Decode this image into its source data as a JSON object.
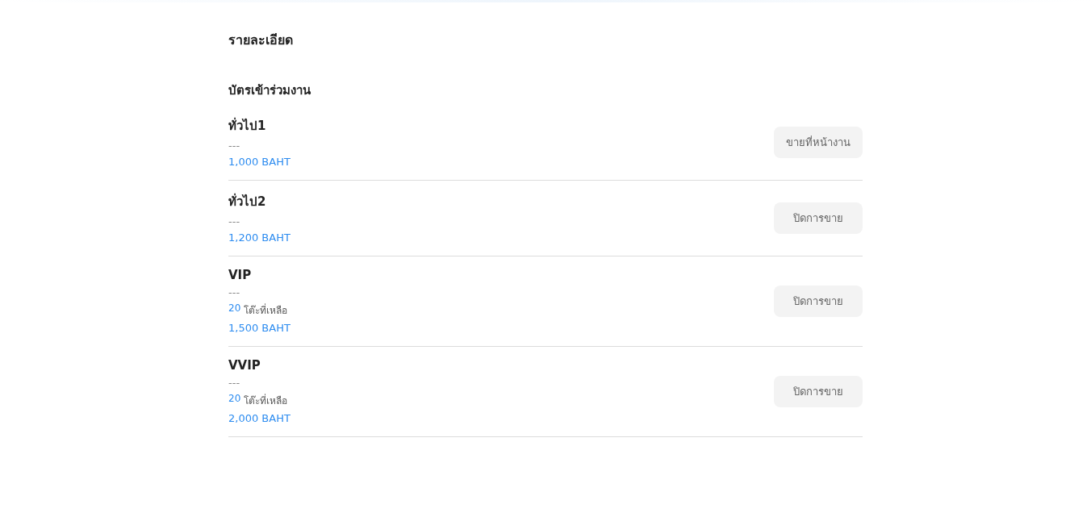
{
  "heading": "รายละเอียด",
  "section_title": "บัตรเข้าร่วมงาน",
  "tickets": [
    {
      "name": "ทั่วไป1",
      "description": "---",
      "price": "1,000 BAHT",
      "action": "ขายที่หน้างาน"
    },
    {
      "name": "ทั่วไป2",
      "description": "---",
      "price": "1,200 BAHT",
      "action": "ปิดการขาย"
    },
    {
      "name": "VIP",
      "description": "---",
      "remaining": {
        "count": "20",
        "label": "โต๊ะที่เหลือ"
      },
      "price": "1,500 BAHT",
      "action": "ปิดการขาย"
    },
    {
      "name": "VVIP",
      "description": "---",
      "remaining": {
        "count": "20",
        "label": "โต๊ะที่เหลือ"
      },
      "price": "2,000 BAHT",
      "action": "ปิดการขาย"
    }
  ]
}
